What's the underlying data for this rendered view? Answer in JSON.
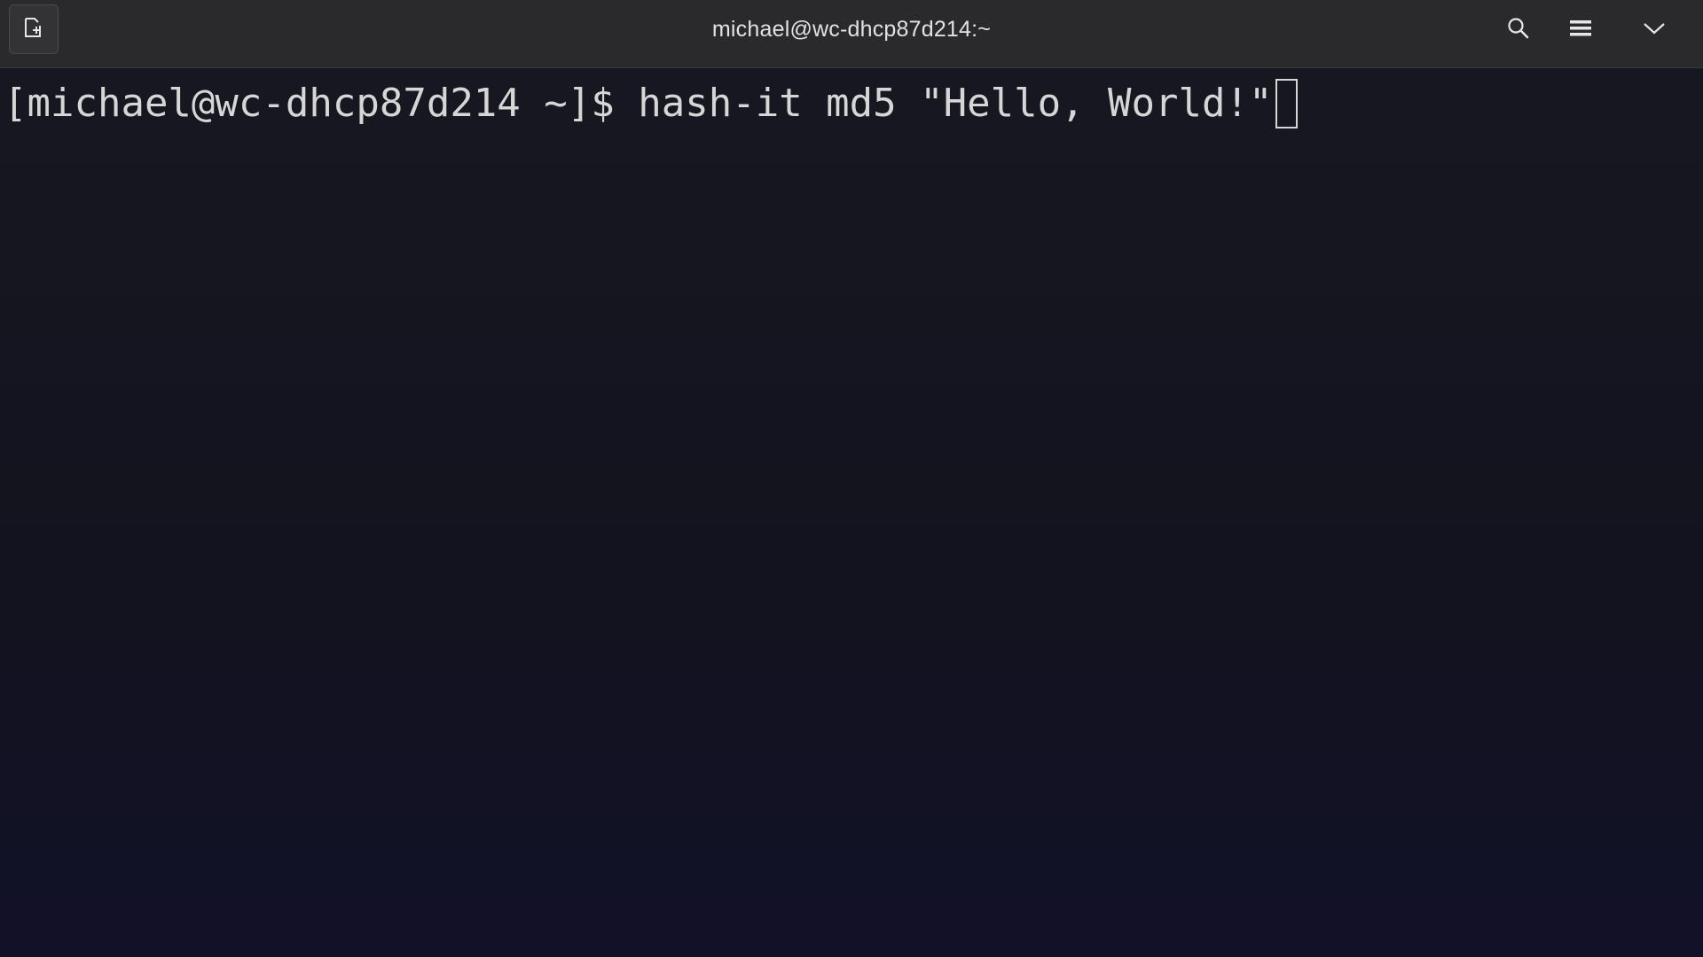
{
  "window": {
    "title": "michael@wc-dhcp87d214:~"
  },
  "titlebar": {
    "new_tab_icon": "new-tab-icon",
    "search_icon": "search-icon",
    "menu_icon": "hamburger-menu-icon",
    "dropdown_icon": "chevron-down-icon"
  },
  "terminal": {
    "prompt": "[michael@wc-dhcp87d214 ~]$ ",
    "command": "hash-it md5 \"Hello, World!\""
  },
  "colors": {
    "titlebar_bg": "#2a2a2c",
    "terminal_bg": "#14141f",
    "text": "#d6d6d6"
  }
}
